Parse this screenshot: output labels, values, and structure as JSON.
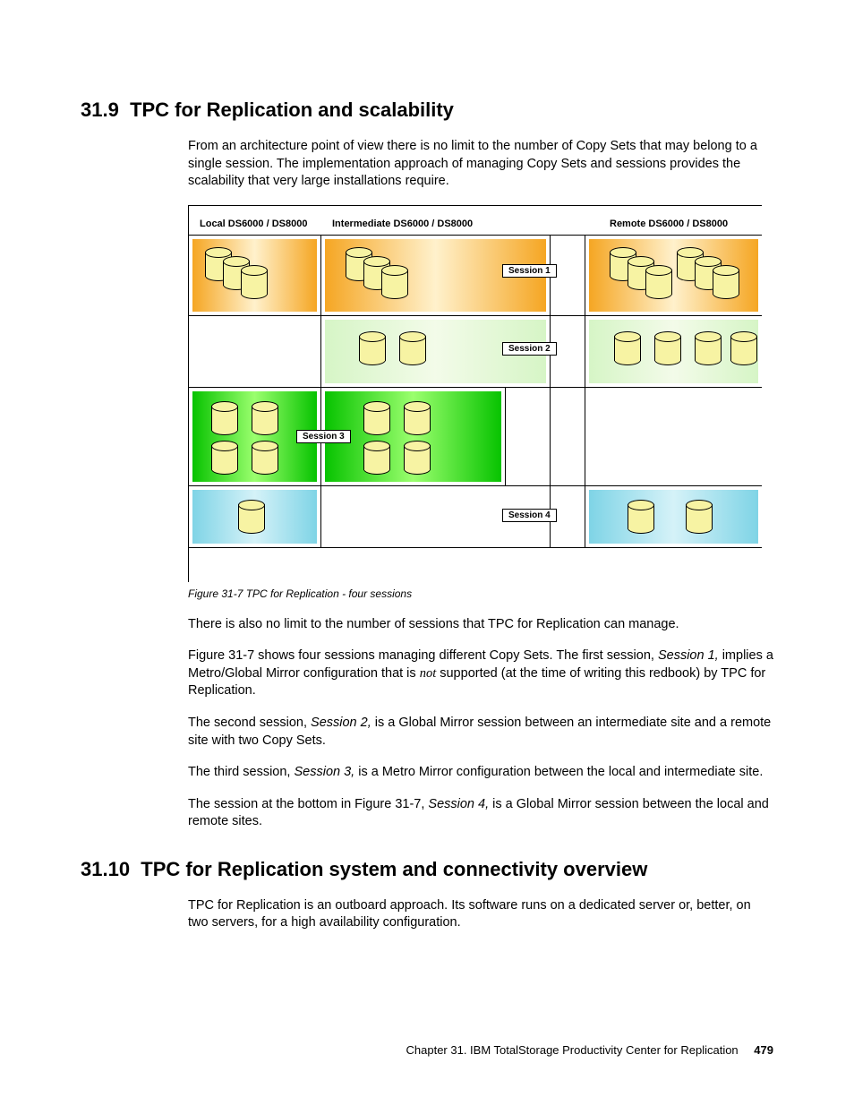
{
  "section1": {
    "number": "31.9",
    "title": "TPC for Replication and scalability",
    "para1": "From an architecture point of view there is no limit to the number of Copy Sets that may belong to a single session. The implementation approach of managing Copy Sets and sessions provides the scalability that very large installations require."
  },
  "figure": {
    "col1": "Local DS6000 / DS8000",
    "col2": "Intermediate DS6000 / DS8000",
    "col3": "Remote DS6000 / DS8000",
    "s1": "Session 1",
    "s2": "Session 2",
    "s3": "Session 3",
    "s4": "Session 4",
    "caption": "Figure 31-7   TPC for Replication - four sessions"
  },
  "after": {
    "p1": "There is also no limit to the number of sessions that TPC for Replication can manage.",
    "p2a": "Figure 31-7 shows four sessions managing different Copy Sets. The first session, ",
    "p2i": "Session 1,",
    "p2b": " implies a Metro/Global Mirror configuration that is ",
    "p2not": "not",
    "p2c": " supported (at the time of writing this redbook) by TPC for Replication.",
    "p3a": "The second session, ",
    "p3i": "Session 2,",
    "p3b": " is a Global Mirror session between an intermediate site and a remote site with two Copy Sets.",
    "p4a": "The third session, ",
    "p4i": "Session 3,",
    "p4b": " is a Metro Mirror configuration between the local and intermediate site.",
    "p5a": "The session at the bottom in Figure 31-7, ",
    "p5i": "Session 4,",
    "p5b": " is a Global Mirror session between the local and remote sites."
  },
  "section2": {
    "number": "31.10",
    "title": "TPC for Replication system and connectivity overview",
    "para1": "TPC for Replication is an outboard approach. Its software runs on a dedicated server or, better, on two servers, for a high availability configuration."
  },
  "footer": {
    "chapter": "Chapter 31. IBM TotalStorage Productivity Center for Replication",
    "page": "479"
  }
}
